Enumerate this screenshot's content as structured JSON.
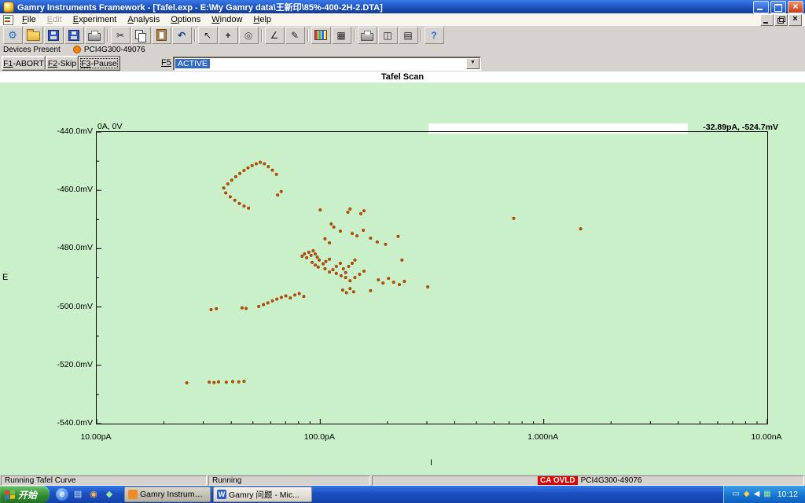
{
  "window": {
    "title": "Gamry Instruments Framework - [Tafel.exp - E:\\My Gamry data\\王新印\\85%-400-2H-2.DTA]"
  },
  "menu_bar": {
    "items": [
      {
        "label": "File",
        "enabled": true
      },
      {
        "label": "Edit",
        "enabled": false
      },
      {
        "label": "Experiment",
        "enabled": true
      },
      {
        "label": "Analysis",
        "enabled": true
      },
      {
        "label": "Options",
        "enabled": true
      },
      {
        "label": "Window",
        "enabled": true
      },
      {
        "label": "Help",
        "enabled": true
      }
    ]
  },
  "toolbar": {
    "buttons": [
      {
        "name": "setup",
        "icon": "gear"
      },
      {
        "name": "open-file",
        "icon": "folder"
      },
      {
        "name": "save",
        "icon": "floppy"
      },
      {
        "name": "save-all",
        "icon": "floppy"
      },
      {
        "name": "print",
        "icon": "printer"
      },
      "sep",
      {
        "name": "cut",
        "icon": "cut"
      },
      {
        "name": "copy",
        "icon": "copy"
      },
      {
        "name": "paste",
        "icon": "paste"
      },
      {
        "name": "undo",
        "icon": "undo"
      },
      "sep",
      {
        "name": "pointer-tool",
        "icon": "pointer"
      },
      {
        "name": "crosshair-tool",
        "icon": "crosshair"
      },
      {
        "name": "zoom-tool",
        "icon": "zoom"
      },
      "sep",
      {
        "name": "slope-tool",
        "icon": "slope"
      },
      {
        "name": "annotate-tool",
        "icon": "pencil"
      },
      "sep",
      {
        "name": "chart-setup",
        "icon": "chart"
      },
      {
        "name": "grid-toggle",
        "icon": "grid"
      },
      "sep",
      {
        "name": "print-preview",
        "icon": "printer"
      },
      {
        "name": "split-window",
        "icon": "split"
      },
      {
        "name": "tile-window",
        "icon": "tile"
      },
      "sep",
      {
        "name": "help",
        "icon": "help"
      }
    ]
  },
  "devices": {
    "label": "Devices Present",
    "device_name": "PCI4G300-49076",
    "indicator_color": "#ff8000"
  },
  "fkeys": {
    "buttons": [
      {
        "key": "F1",
        "label": "ABORT",
        "focused": false
      },
      {
        "key": "F2",
        "label": "Skip",
        "focused": false
      },
      {
        "key": "F3",
        "label": "Pause",
        "focused": true
      }
    ],
    "f5_key": "F5",
    "f5_value": "ACTIVE"
  },
  "chart_data": {
    "type": "scatter",
    "title": "Tafel Scan",
    "xlabel": "I",
    "ylabel": "E",
    "x_scale": "log",
    "x_range_pA": [
      10,
      10000
    ],
    "y_range_mV": [
      -540,
      -440
    ],
    "x_ticks": [
      {
        "v": 10,
        "label": "10.00pA"
      },
      {
        "v": 100,
        "label": "100.0pA"
      },
      {
        "v": 1000,
        "label": "1.000nA"
      },
      {
        "v": 10000,
        "label": "10.00nA"
      }
    ],
    "y_ticks": [
      {
        "v": -440,
        "label": "-440.0mV"
      },
      {
        "v": -460,
        "label": "-460.0mV"
      },
      {
        "v": -480,
        "label": "-480.0mV"
      },
      {
        "v": -500,
        "label": "-500.0mV"
      },
      {
        "v": -520,
        "label": "-520.0mV"
      },
      {
        "v": -540,
        "label": "-540.0mV"
      }
    ],
    "grid": false,
    "corner_label": "0A, 0V",
    "cursor_readout": "-32.89pA, -524.7mV",
    "point_color": "#c85000",
    "points_pA_mV": [
      [
        37,
        -459.2
      ],
      [
        38.6,
        -457.8
      ],
      [
        40.2,
        -456.5
      ],
      [
        41.9,
        -455.3
      ],
      [
        43.7,
        -454.2
      ],
      [
        45.6,
        -453.2
      ],
      [
        47.5,
        -452.3
      ],
      [
        49.6,
        -451.5
      ],
      [
        51.7,
        -450.9
      ],
      [
        53.9,
        -450.4
      ],
      [
        56.2,
        -450.9
      ],
      [
        58.6,
        -451.9
      ],
      [
        61.1,
        -453.1
      ],
      [
        63.7,
        -454.5
      ],
      [
        37.8,
        -460.9
      ],
      [
        39.6,
        -462.2
      ],
      [
        41.5,
        -463.4
      ],
      [
        43.5,
        -464.5
      ],
      [
        45.6,
        -465.4
      ],
      [
        47.8,
        -466.1
      ],
      [
        64.5,
        -461.6
      ],
      [
        66.9,
        -460.4
      ],
      [
        32.5,
        -500.9
      ],
      [
        34.3,
        -500.6
      ],
      [
        44.7,
        -500.3
      ],
      [
        46.6,
        -500.5
      ],
      [
        53.1,
        -499.8
      ],
      [
        55.7,
        -499.2
      ],
      [
        58.3,
        -498.6
      ],
      [
        61.1,
        -497.9
      ],
      [
        64,
        -497.3
      ],
      [
        67,
        -496.7
      ],
      [
        70.2,
        -496.2
      ],
      [
        73.5,
        -496.9
      ],
      [
        77,
        -495.9
      ],
      [
        80.6,
        -495.4
      ],
      [
        84.4,
        -496.4
      ],
      [
        25.3,
        -526
      ],
      [
        31.9,
        -525.8
      ],
      [
        33.5,
        -525.9
      ],
      [
        35.1,
        -525.7
      ],
      [
        38,
        -525.8
      ],
      [
        40.6,
        -525.6
      ],
      [
        43.2,
        -525.7
      ],
      [
        45.6,
        -525.5
      ],
      [
        83,
        -482.6
      ],
      [
        85,
        -481.8
      ],
      [
        87,
        -483.1
      ],
      [
        89,
        -481.2
      ],
      [
        91,
        -482.3
      ],
      [
        93,
        -480.7
      ],
      [
        95,
        -481.8
      ],
      [
        97,
        -482.9
      ],
      [
        99,
        -483.9
      ],
      [
        92,
        -484.7
      ],
      [
        95,
        -485.6
      ],
      [
        98,
        -486.3
      ],
      [
        103,
        -485.2
      ],
      [
        106,
        -484.4
      ],
      [
        110,
        -483.6
      ],
      [
        105,
        -486.9
      ],
      [
        110,
        -488
      ],
      [
        114,
        -487.2
      ],
      [
        118,
        -486.1
      ],
      [
        123,
        -485
      ],
      [
        118,
        -488.5
      ],
      [
        124,
        -489.3
      ],
      [
        130,
        -488.2
      ],
      [
        127,
        -486.9
      ],
      [
        134,
        -486.1
      ],
      [
        139,
        -485
      ],
      [
        143,
        -483.9
      ],
      [
        130,
        -489.9
      ],
      [
        136,
        -491
      ],
      [
        143,
        -489.9
      ],
      [
        150,
        -488.8
      ],
      [
        157,
        -487.7
      ],
      [
        100,
        -466.7
      ],
      [
        133,
        -467.5
      ],
      [
        136,
        -466.4
      ],
      [
        152,
        -468
      ],
      [
        157,
        -467
      ],
      [
        112,
        -471.5
      ],
      [
        115,
        -472.6
      ],
      [
        123,
        -474
      ],
      [
        139,
        -474.8
      ],
      [
        146,
        -475.6
      ],
      [
        156,
        -473.7
      ],
      [
        196,
        -478.5
      ],
      [
        110,
        -478
      ],
      [
        105,
        -476.6
      ],
      [
        168,
        -476.4
      ],
      [
        180,
        -477.7
      ],
      [
        223,
        -475.8
      ],
      [
        232,
        -483.9
      ],
      [
        182,
        -490.7
      ],
      [
        191,
        -491.8
      ],
      [
        202,
        -490.2
      ],
      [
        213,
        -491.5
      ],
      [
        226,
        -492.3
      ],
      [
        238,
        -491.2
      ],
      [
        303,
        -493.1
      ],
      [
        168,
        -494.4
      ],
      [
        126,
        -494.2
      ],
      [
        131,
        -495.1
      ],
      [
        136,
        -493.7
      ],
      [
        141,
        -494.8
      ],
      [
        734,
        -469.6
      ],
      [
        1462,
        -473.2
      ]
    ]
  },
  "status": {
    "task": "Running Tafel Curve",
    "state": "Running",
    "alert": "CA OVLD",
    "device": "PCI4G300-49076"
  },
  "taskbar": {
    "start_label": "开始",
    "quick_launch": [
      {
        "name": "internet-explorer-icon",
        "glyph": "e",
        "cls": "ie"
      },
      {
        "name": "show-desktop-icon",
        "glyph": "▤",
        "color": "#cfe6ff"
      },
      {
        "name": "media-player-icon",
        "glyph": "◉",
        "color": "#ffb347"
      },
      {
        "name": "messenger-icon",
        "glyph": "◆",
        "color": "#9fe6a0"
      }
    ],
    "tasks": [
      {
        "label": "Gamry Instrument...",
        "icon_bg": "#f08a24",
        "icon_glyph": "",
        "active": true
      },
      {
        "label": "Gamry 问题 - Mic...",
        "icon_bg": "#2b5cc8",
        "icon_glyph": "W",
        "active": false
      }
    ],
    "tray": {
      "icons": [
        {
          "name": "printer-icon",
          "glyph": "▭",
          "color": "#e8e8e8"
        },
        {
          "name": "security-icon",
          "glyph": "◆",
          "color": "#ffd24a"
        },
        {
          "name": "volume-icon",
          "glyph": "◀",
          "color": "#ffffff"
        },
        {
          "name": "network-icon",
          "glyph": "▦",
          "color": "#9fe6a0"
        }
      ],
      "time": "10:12"
    }
  }
}
